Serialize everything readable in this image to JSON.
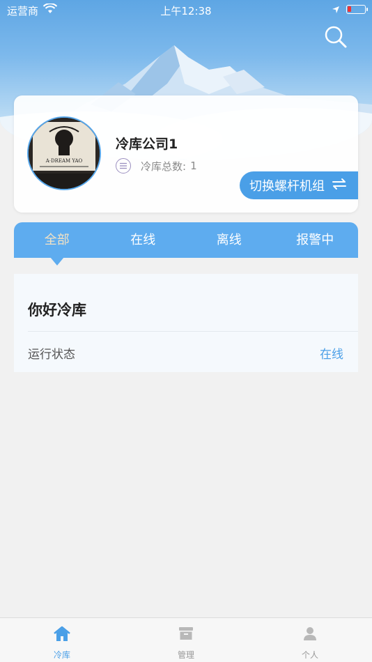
{
  "status_bar": {
    "carrier": "运营商",
    "time": "上午12:38"
  },
  "profile": {
    "avatar_text": "A·DREAM YAO",
    "company_name": "冷库公司1",
    "count_label": "冷库总数:",
    "count_value": "1",
    "switch_button": "切换螺杆机组"
  },
  "tabs": [
    {
      "label": "全部",
      "active": true
    },
    {
      "label": "在线",
      "active": false
    },
    {
      "label": "离线",
      "active": false
    },
    {
      "label": "报警中",
      "active": false
    }
  ],
  "device": {
    "name": "你好冷库",
    "status_label": "运行状态",
    "status_value": "在线"
  },
  "tabbar": [
    {
      "label": "冷库",
      "icon": "home-icon",
      "active": true
    },
    {
      "label": "管理",
      "icon": "archive-icon",
      "active": false
    },
    {
      "label": "个人",
      "icon": "person-icon",
      "active": false
    }
  ],
  "colors": {
    "accent": "#4a9fe7",
    "tab_bg": "#5eacef",
    "active_tab_text": "#f3e2c4"
  }
}
